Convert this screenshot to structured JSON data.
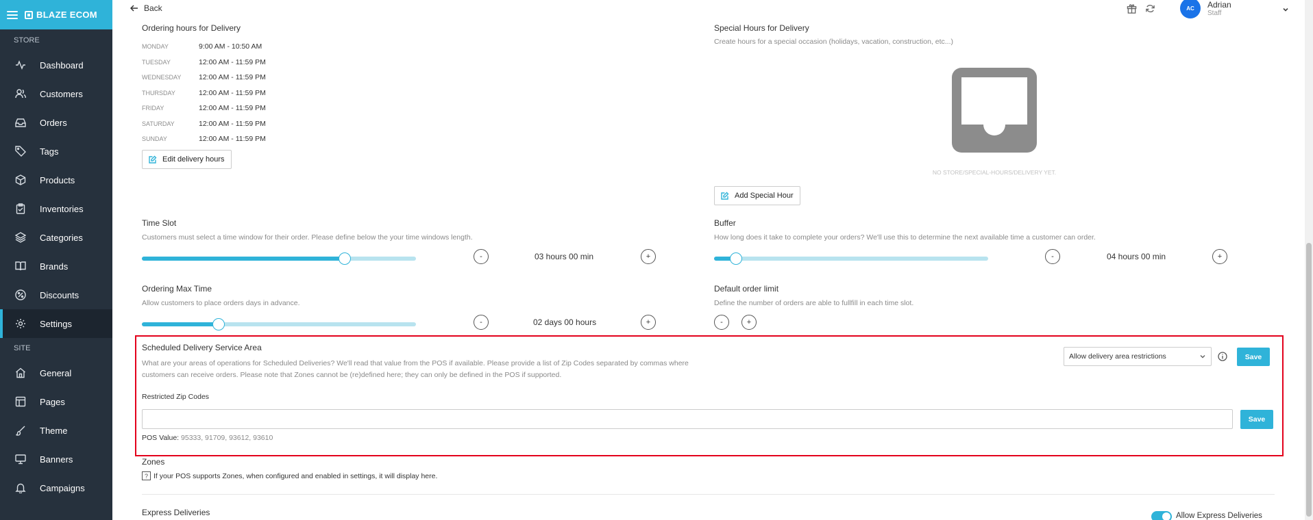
{
  "sidebar": {
    "brand": "BLAZE ECOM",
    "section_store": "STORE",
    "section_site": "SITE",
    "store_items": [
      {
        "label": "Dashboard"
      },
      {
        "label": "Customers"
      },
      {
        "label": "Orders"
      },
      {
        "label": "Tags"
      },
      {
        "label": "Products"
      },
      {
        "label": "Inventories"
      },
      {
        "label": "Categories"
      },
      {
        "label": "Brands"
      },
      {
        "label": "Discounts"
      },
      {
        "label": "Settings"
      }
    ],
    "site_items": [
      {
        "label": "General"
      },
      {
        "label": "Pages"
      },
      {
        "label": "Theme"
      },
      {
        "label": "Banners"
      },
      {
        "label": "Campaigns"
      }
    ],
    "active_item": "Settings"
  },
  "topbar": {
    "back_label": "Back",
    "user_initials": "AC",
    "user_name": "Adrian",
    "user_role": "Staff"
  },
  "ordering_hours": {
    "title": "Ordering hours for Delivery",
    "rows": [
      {
        "day": "MONDAY",
        "hours": "9:00 AM - 10:50 AM"
      },
      {
        "day": "TUESDAY",
        "hours": "12:00 AM - 11:59 PM"
      },
      {
        "day": "WEDNESDAY",
        "hours": "12:00 AM - 11:59 PM"
      },
      {
        "day": "THURSDAY",
        "hours": "12:00 AM - 11:59 PM"
      },
      {
        "day": "FRIDAY",
        "hours": "12:00 AM - 11:59 PM"
      },
      {
        "day": "SATURDAY",
        "hours": "12:00 AM - 11:59 PM"
      },
      {
        "day": "SUNDAY",
        "hours": "12:00 AM - 11:59 PM"
      }
    ],
    "edit_label": "Edit delivery hours"
  },
  "special_hours": {
    "title": "Special Hours for Delivery",
    "description": "Create hours for a special occasion (holidays, vacation, construction, etc...)",
    "empty_text": "NO STORE/SPECIAL-HOURS/DELIVERY YET.",
    "add_label": "Add Special Hour"
  },
  "time_slot": {
    "title": "Time Slot",
    "description": "Customers must select a time window for their order. Please define below the your time windows length.",
    "value": "03 hours 00 min",
    "fraction": 0.74,
    "minus": "-",
    "plus": "+"
  },
  "buffer": {
    "title": "Buffer",
    "description": "How long does it take to complete your orders? We'll use this to determine the next available time a customer can order.",
    "value": "04 hours 00 min",
    "fraction": 0.08,
    "minus": "-",
    "plus": "+"
  },
  "ordering_max": {
    "title": "Ordering Max Time",
    "description": "Allow customers to place orders days in advance.",
    "value": "02 days 00 hours",
    "fraction": 0.28,
    "minus": "-",
    "plus": "+"
  },
  "order_limit": {
    "title": "Default order limit",
    "description": "Define the number of orders are able to fullfill in each time slot.",
    "minus": "-",
    "plus": "+"
  },
  "service_area": {
    "title": "Scheduled Delivery Service Area",
    "description_line1": "What are your areas of operations for Scheduled Deliveries? We'll read that value from the POS if available. Please provide a list of Zip Codes separated by commas where",
    "description_line2": "customers can receive orders. Please note that Zones cannot be (re)defined here; they can only be defined in the POS if supported.",
    "select_value": "Allow delivery area restrictions",
    "save_label": "Save",
    "zip_label": "Restricted Zip Codes",
    "zip_value": "",
    "zip_save_label": "Save",
    "pos_label": "POS Value:",
    "pos_value": "95333, 91709, 93612, 93610"
  },
  "zones": {
    "title": "Zones",
    "help_glyph": "?",
    "description": "If your POS supports Zones, when configured and enabled in settings, it will display here."
  },
  "express": {
    "title": "Express Deliveries",
    "toggle_label": "Allow Express Deliveries"
  },
  "colors": {
    "accent": "#2fb3d9",
    "sidebar_bg": "#26313d",
    "highlight_border": "#e3001b"
  }
}
